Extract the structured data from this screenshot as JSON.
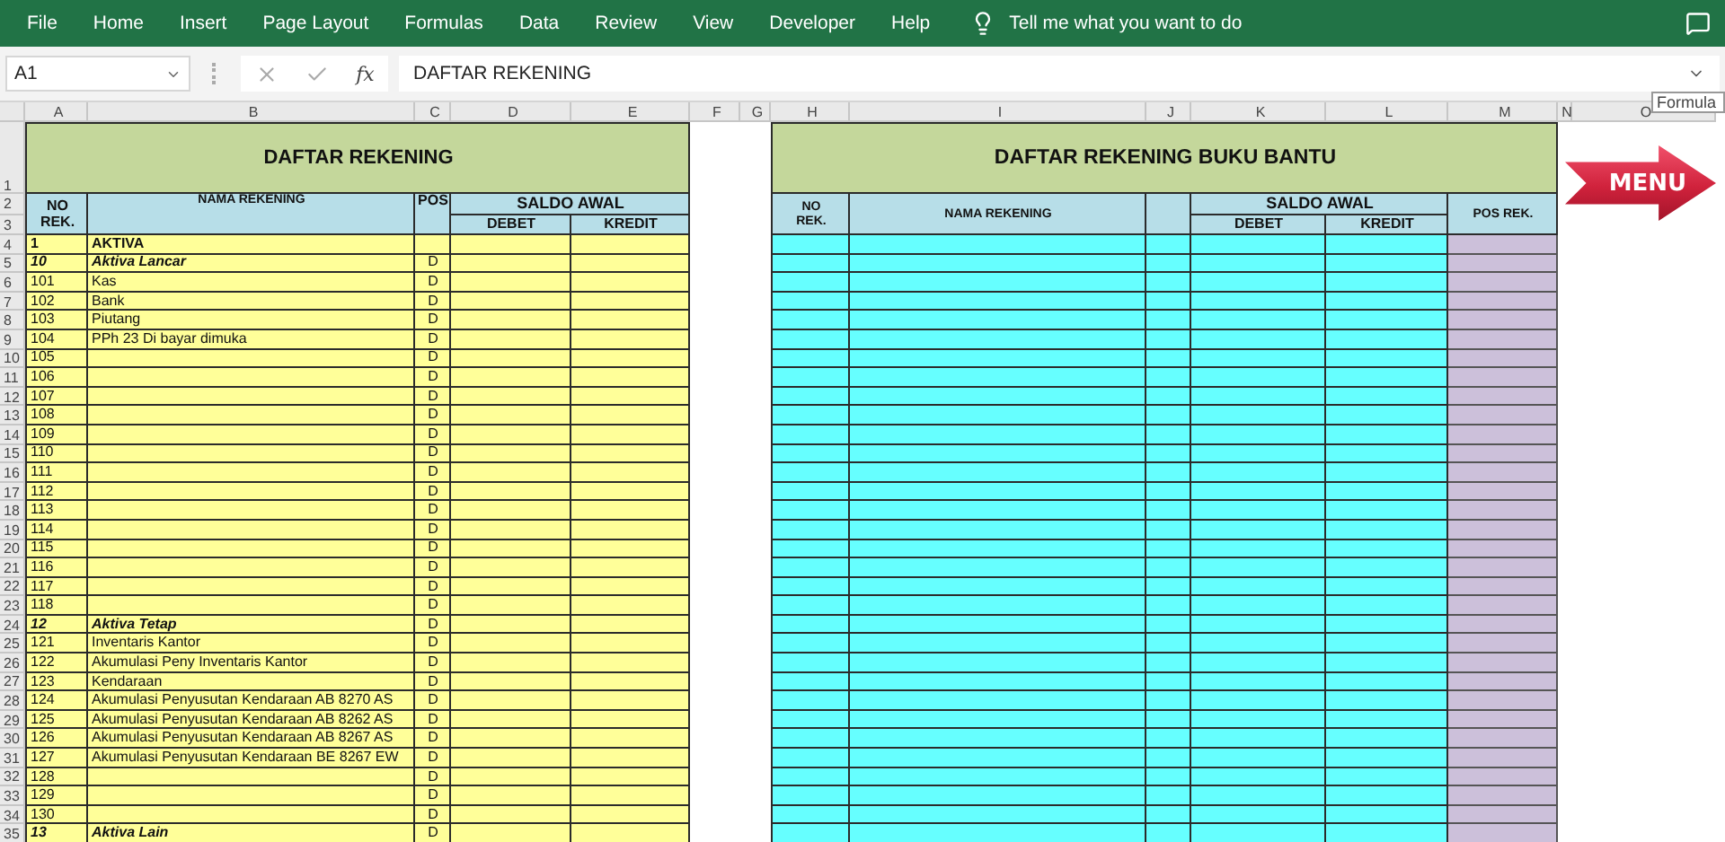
{
  "ribbon": {
    "tabs": [
      "File",
      "Home",
      "Insert",
      "Page Layout",
      "Formulas",
      "Data",
      "Review",
      "View",
      "Developer",
      "Help"
    ],
    "tell_me": "Tell me what you want to do"
  },
  "formula_bar": {
    "name_box": "A1",
    "function_label": "fx",
    "formula": "DAFTAR REKENING"
  },
  "tooltip": "Formula",
  "sheet": {
    "column_headers": [
      "A",
      "B",
      "C",
      "D",
      "E",
      "F",
      "G",
      "H",
      "I",
      "J",
      "K",
      "L",
      "M",
      "N",
      "O"
    ],
    "header_row_numbers": [
      "1",
      "2",
      "3"
    ],
    "left_table": {
      "title": "DAFTAR REKENING",
      "no_rek": [
        "NO",
        "REK."
      ],
      "nama": "NAMA REKENING",
      "pos": "POS",
      "saldo": "SALDO AWAL",
      "debet": "DEBET",
      "kredit": "KREDIT"
    },
    "right_table": {
      "title": "DAFTAR REKENING BUKU BANTU",
      "no_rek": [
        "NO",
        "REK."
      ],
      "nama": "NAMA REKENING",
      "saldo": "SALDO AWAL",
      "debet": "DEBET",
      "kredit": "KREDIT",
      "pos_rek": "POS REK."
    },
    "rows": [
      {
        "row": "4",
        "kind": "heading",
        "no": "1",
        "name": "AKTIVA"
      },
      {
        "row": "5",
        "kind": "group",
        "no": "10",
        "name": "Aktiva Lancar",
        "pos": "D"
      },
      {
        "row": "6",
        "kind": "account",
        "no": "101",
        "name": "Kas",
        "pos": "D"
      },
      {
        "row": "7",
        "kind": "account",
        "no": "102",
        "name": "Bank",
        "pos": "D"
      },
      {
        "row": "8",
        "kind": "account",
        "no": "103",
        "name": "Piutang",
        "pos": "D"
      },
      {
        "row": "9",
        "kind": "account",
        "no": "104",
        "name": "PPh 23 Di bayar dimuka",
        "pos": "D"
      },
      {
        "row": "10",
        "kind": "account",
        "no": "105",
        "pos": "D"
      },
      {
        "row": "11",
        "kind": "account",
        "no": "106",
        "pos": "D"
      },
      {
        "row": "12",
        "kind": "account",
        "no": "107",
        "pos": "D"
      },
      {
        "row": "13",
        "kind": "account",
        "no": "108",
        "pos": "D"
      },
      {
        "row": "14",
        "kind": "account",
        "no": "109",
        "pos": "D"
      },
      {
        "row": "15",
        "kind": "account",
        "no": "110",
        "pos": "D"
      },
      {
        "row": "16",
        "kind": "account",
        "no": "111",
        "pos": "D"
      },
      {
        "row": "17",
        "kind": "account",
        "no": "112",
        "pos": "D"
      },
      {
        "row": "18",
        "kind": "account",
        "no": "113",
        "pos": "D"
      },
      {
        "row": "19",
        "kind": "account",
        "no": "114",
        "pos": "D"
      },
      {
        "row": "20",
        "kind": "account",
        "no": "115",
        "pos": "D"
      },
      {
        "row": "21",
        "kind": "account",
        "no": "116",
        "pos": "D"
      },
      {
        "row": "22",
        "kind": "account",
        "no": "117",
        "pos": "D"
      },
      {
        "row": "23",
        "kind": "account",
        "no": "118",
        "pos": "D"
      },
      {
        "row": "24",
        "kind": "group",
        "no": "12",
        "name": "Aktiva Tetap",
        "pos": "D"
      },
      {
        "row": "25",
        "kind": "account",
        "no": "121",
        "name": "Inventaris Kantor",
        "pos": "D"
      },
      {
        "row": "26",
        "kind": "account",
        "no": "122",
        "name": "Akumulasi Peny Inventaris Kantor",
        "pos": "D"
      },
      {
        "row": "27",
        "kind": "account",
        "no": "123",
        "name": "Kendaraan",
        "pos": "D"
      },
      {
        "row": "28",
        "kind": "account",
        "no": "124",
        "name": "Akumulasi Penyusutan Kendaraan AB 8270 AS",
        "pos": "D"
      },
      {
        "row": "29",
        "kind": "account",
        "no": "125",
        "name": "Akumulasi Penyusutan Kendaraan AB 8262 AS",
        "pos": "D"
      },
      {
        "row": "30",
        "kind": "account",
        "no": "126",
        "name": "Akumulasi Penyusutan Kendaraan AB 8267 AS",
        "pos": "D"
      },
      {
        "row": "31",
        "kind": "account",
        "no": "127",
        "name": "Akumulasi Penyusutan Kendaraan BE 8267 EW",
        "pos": "D"
      },
      {
        "row": "32",
        "kind": "account",
        "no": "128",
        "pos": "D"
      },
      {
        "row": "33",
        "kind": "account",
        "no": "129",
        "pos": "D"
      },
      {
        "row": "34",
        "kind": "account",
        "no": "130",
        "pos": "D"
      },
      {
        "row": "35",
        "kind": "group",
        "no": "13",
        "name": "Aktiva Lain",
        "pos": "D"
      }
    ],
    "menu_button": "MENU"
  }
}
